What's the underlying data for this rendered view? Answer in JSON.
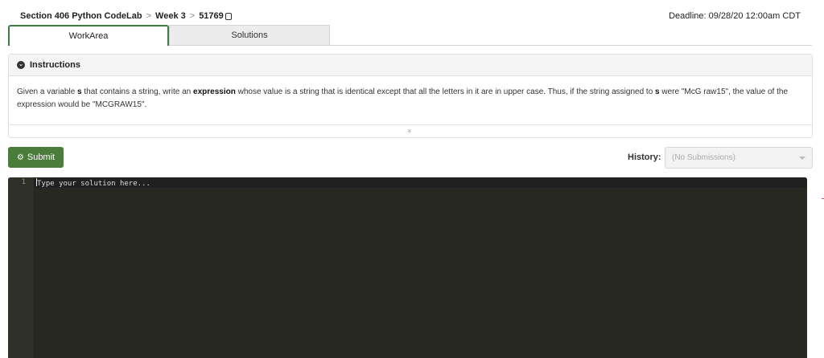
{
  "breadcrumb": {
    "course": "Section 406 Python CodeLab",
    "separator": ">",
    "week": "Week 3",
    "exercise_id": "51769"
  },
  "deadline": "Deadline: 09/28/20 12:00am CDT",
  "tabs": [
    {
      "label": "WorkArea",
      "active": true
    },
    {
      "label": "Solutions",
      "active": false
    }
  ],
  "instructions": {
    "title": "Instructions",
    "text_1": "Given a variable ",
    "var_1": "s",
    "text_2": " that contains a string, write an ",
    "bold_1": "expression",
    "text_3": " whose value is a string that is identical except that all the letters in it are in upper case. Thus, if the string assigned to ",
    "var_2": "s",
    "text_4": " were \"McG raw15\", the value of the expression would be \"MCGRAW15\".",
    "expand_glyph": "»"
  },
  "submit_label": "Submit",
  "history": {
    "label": "History:",
    "selected": "(No Submissions)"
  },
  "editor": {
    "line_number": "1",
    "placeholder": "Type your solution here..."
  },
  "colors": {
    "accent_green": "#4a7c3a",
    "tab_border": "#3f7b45",
    "editor_bg": "#272822"
  }
}
